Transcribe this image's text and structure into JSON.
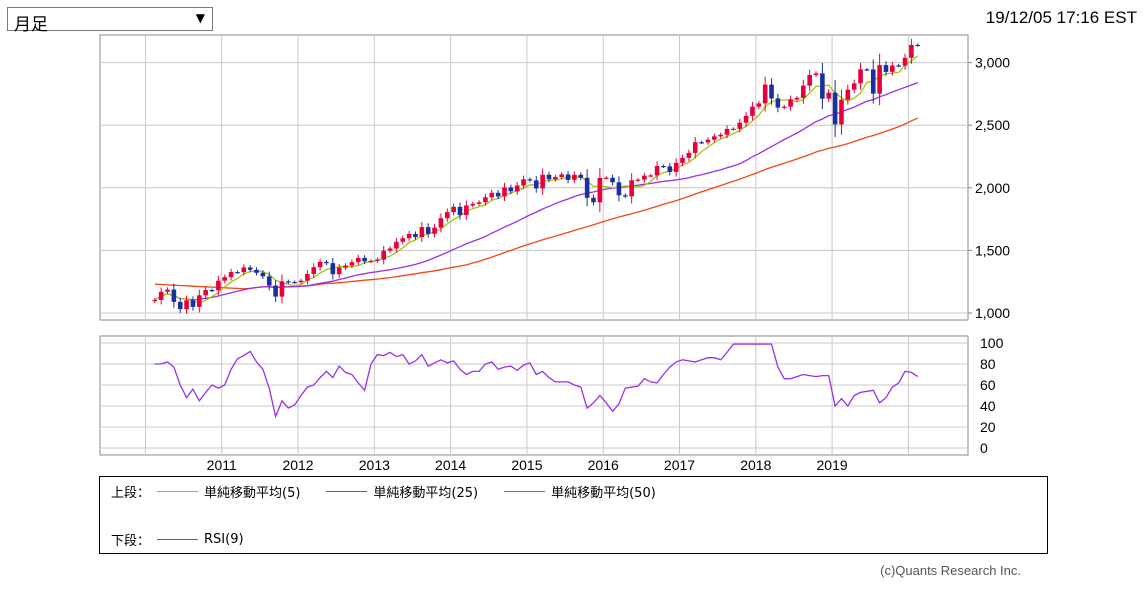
{
  "header": {
    "period_selected": "月足",
    "dropdown_arrow": "▼",
    "timestamp": "19/12/05 17:16 EST"
  },
  "legend": {
    "upper_label": "上段：",
    "lower_label": "下段：",
    "items_upper": [
      {
        "name": "単純移動平均(5)",
        "color": "#a8c40a"
      },
      {
        "name": "単純移動平均(25)",
        "color": "#9b30e8"
      },
      {
        "name": "単純移動平均(50)",
        "color": "#f04818"
      }
    ],
    "items_lower": [
      {
        "name": "RSI(9)",
        "color": "#9b30e8"
      }
    ]
  },
  "copyright": "(c)Quants Research Inc.",
  "chart_data": [
    {
      "type": "candlestick",
      "title": "",
      "xlabel": "",
      "ylabel": "",
      "ylim": [
        980,
        3200
      ],
      "yticks": [
        1000,
        1500,
        2000,
        2500,
        3000
      ],
      "ytick_labels": [
        "1,000",
        "1,500",
        "2,000",
        "2,500",
        "3,000"
      ],
      "x_tick_labels": [
        "2011",
        "2012",
        "2013",
        "2014",
        "2015",
        "2016",
        "2017",
        "2018",
        "2019"
      ],
      "grid": true,
      "colors": {
        "up": "#e8003c",
        "down": "#1a2fa0"
      },
      "period_start": "2010-02",
      "interval": "monthly",
      "close": [
        1104,
        1169,
        1187,
        1089,
        1031,
        1102,
        1049,
        1141,
        1183,
        1181,
        1258,
        1286,
        1327,
        1326,
        1364,
        1345,
        1321,
        1293,
        1219,
        1131,
        1253,
        1247,
        1246,
        1258,
        1312,
        1366,
        1408,
        1398,
        1310,
        1362,
        1379,
        1406,
        1440,
        1412,
        1416,
        1426,
        1498,
        1515,
        1569,
        1597,
        1631,
        1606,
        1686,
        1633,
        1682,
        1757,
        1806,
        1848,
        1782,
        1859,
        1872,
        1884,
        1924,
        1960,
        1931,
        2003,
        1972,
        2018,
        2068,
        2059,
        1995,
        2104,
        2068,
        2086,
        2107,
        2063,
        2104,
        2080,
        1920,
        1884,
        2079,
        2080,
        2044,
        1940,
        1932,
        2060,
        2065,
        2097,
        2099,
        2174,
        2171,
        2127,
        2199,
        2239,
        2279,
        2364,
        2363,
        2384,
        2411,
        2424,
        2470,
        2471,
        2520,
        2575,
        2648,
        2674,
        2824,
        2714,
        2641,
        2648,
        2705,
        2718,
        2816,
        2901,
        2914,
        2712,
        2760,
        2506,
        2704,
        2784,
        2834,
        2946,
        2945,
        2752,
        2980,
        2926,
        2977,
        2976,
        3038,
        3141,
        3140
      ],
      "rsi": [
        80,
        80,
        82,
        77,
        60,
        48,
        56,
        45,
        53,
        60,
        57,
        60,
        75,
        85,
        88,
        92,
        82,
        75,
        57,
        30,
        45,
        38,
        41,
        50,
        58,
        60,
        67,
        73,
        67,
        78,
        72,
        70,
        62,
        55,
        80,
        89,
        88,
        91,
        87,
        89,
        80,
        83,
        89,
        78,
        81,
        84,
        81,
        83,
        75,
        70,
        73,
        73,
        80,
        82,
        75,
        77,
        78,
        74,
        79,
        81,
        70,
        73,
        67,
        63,
        63,
        63,
        60,
        58,
        38,
        43,
        50,
        43,
        35,
        42,
        57,
        58,
        59,
        66,
        63,
        62,
        70,
        77,
        82,
        84,
        83,
        82,
        84,
        86,
        86,
        84,
        91,
        99,
        99,
        99,
        99,
        99,
        99,
        99,
        77,
        66,
        66,
        68,
        70,
        69,
        68,
        69,
        69,
        40,
        47,
        40,
        50,
        53,
        54,
        55,
        43,
        48,
        58,
        62,
        73,
        72,
        68
      ]
    },
    {
      "type": "line",
      "title": "",
      "ylim": [
        0,
        100
      ],
      "yticks": [
        0,
        20,
        40,
        60,
        80,
        100
      ],
      "grid": true
    }
  ]
}
